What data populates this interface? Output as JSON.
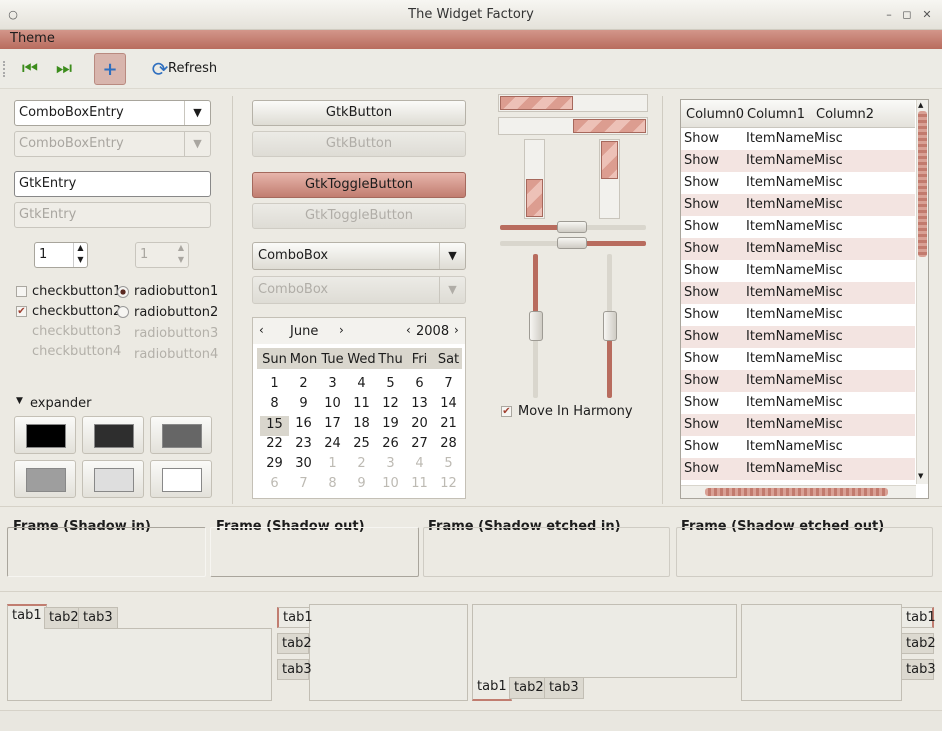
{
  "window": {
    "title": "The Widget Factory",
    "controls": [
      "○",
      "–",
      "◻",
      "✕"
    ]
  },
  "menubar": {
    "items": [
      "Theme"
    ]
  },
  "toolbar": {
    "refresh_label": "Refresh"
  },
  "left": {
    "combo_entry": "ComboBoxEntry",
    "combo_entry_disabled": "ComboBoxEntry",
    "entry": "GtkEntry",
    "entry_disabled": "GtkEntry",
    "spin_value": "1",
    "spin_value_disabled": "1",
    "check1": "checkbutton1",
    "check2": "checkbutton2",
    "check3": "checkbutton3",
    "check4": "checkbutton4",
    "radio1": "radiobutton1",
    "radio2": "radiobutton2",
    "radio3": "radiobutton3",
    "radio4": "radiobutton4",
    "expander": "expander",
    "swatches": [
      "#000000",
      "#2e2e2e",
      "#666666",
      "#9e9e9e",
      "#dedede",
      "#ffffff"
    ]
  },
  "middle": {
    "button": "GtkButton",
    "button_disabled": "GtkButton",
    "toggle": "GtkToggleButton",
    "toggle_disabled": "GtkToggleButton",
    "combo": "ComboBox",
    "combo_disabled": "ComboBox"
  },
  "calendar": {
    "month": "June",
    "year": "2008",
    "weekdays": [
      "Sun",
      "Mon",
      "Tue",
      "Wed",
      "Thu",
      "Fri",
      "Sat"
    ],
    "selected_day": "15",
    "rows": [
      [
        "",
        "",
        "",
        "",
        "",
        "",
        ""
      ],
      [
        "1",
        "2",
        "3",
        "4",
        "5",
        "6",
        "7"
      ],
      [
        "8",
        "9",
        "10",
        "11",
        "12",
        "13",
        "14"
      ],
      [
        "15",
        "16",
        "17",
        "18",
        "19",
        "20",
        "21"
      ],
      [
        "22",
        "23",
        "24",
        "25",
        "26",
        "27",
        "28"
      ],
      [
        "29",
        "30",
        "1",
        "2",
        "3",
        "4",
        "5"
      ],
      [
        "6",
        "7",
        "8",
        "9",
        "10",
        "11",
        "12"
      ]
    ]
  },
  "scales": {
    "harmony_label": "Move In Harmony",
    "harmony_checked": true
  },
  "progress": {
    "h1": 0.5,
    "h2": 0.5,
    "v1": 0.5,
    "v2": 0.5
  },
  "tree": {
    "columns": [
      "Column0",
      "Column1",
      "Column2"
    ],
    "rows": [
      [
        "Show",
        "ItemName",
        "Misc"
      ],
      [
        "Show",
        "ItemName",
        "Misc"
      ],
      [
        "Show",
        "ItemName",
        "Misc"
      ],
      [
        "Show",
        "ItemName",
        "Misc"
      ],
      [
        "Show",
        "ItemName",
        "Misc"
      ],
      [
        "Show",
        "ItemName",
        "Misc"
      ],
      [
        "Show",
        "ItemName",
        "Misc"
      ],
      [
        "Show",
        "ItemName",
        "Misc"
      ],
      [
        "Show",
        "ItemName",
        "Misc"
      ],
      [
        "Show",
        "ItemName",
        "Misc"
      ],
      [
        "Show",
        "ItemName",
        "Misc"
      ],
      [
        "Show",
        "ItemName",
        "Misc"
      ],
      [
        "Show",
        "ItemName",
        "Misc"
      ],
      [
        "Show",
        "ItemName",
        "Misc"
      ],
      [
        "Show",
        "ItemName",
        "Misc"
      ],
      [
        "Show",
        "ItemName",
        "Misc"
      ]
    ]
  },
  "frames": [
    "Frame (Shadow in)",
    "Frame (Shadow out)",
    "Frame (Shadow etched in)",
    "Frame (Shadow etched out)"
  ],
  "notebooks": {
    "tabs": [
      "tab1",
      "tab2",
      "tab3"
    ]
  },
  "colors": {
    "accent": "#c17d70",
    "menubar": "#b86c5e",
    "row_alt": "#f3e4e1"
  }
}
